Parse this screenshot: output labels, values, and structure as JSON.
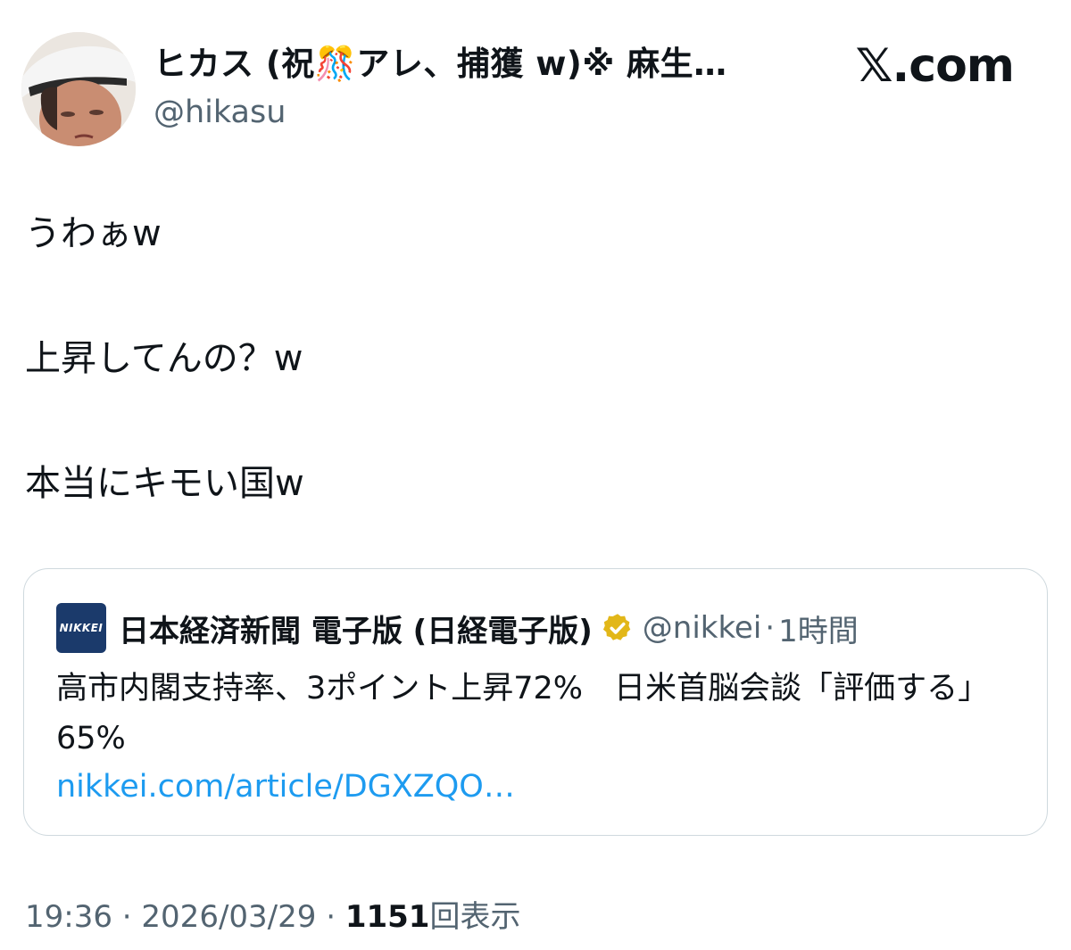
{
  "header": {
    "display_name": "ヒカス (祝🎊アレ、捕獲 w)※ 麻生…",
    "handle": "@hikasu",
    "brand": "𝕏.com"
  },
  "tweet": {
    "lines": [
      "うわぁw",
      "上昇してんの？w",
      "本当にキモい国w"
    ]
  },
  "quote": {
    "logo_text": "NIKKEI",
    "name": "日本経済新聞 電子版 (日経電子版)",
    "handle": "@nikkei",
    "separator": "·",
    "time": "1時間",
    "text": "高市内閣支持率、3ポイント上昇72%　日米首脳会談「評価する」65%",
    "link": "nikkei.com/article/DGXZQO…"
  },
  "meta": {
    "time": "19:36",
    "sep1": "·",
    "date": "2026/03/29",
    "sep2": "·",
    "views_count": "1151",
    "views_label": "回表示"
  },
  "colors": {
    "text": "#0f1419",
    "secondary": "#536471",
    "link": "#1d9bf0",
    "border": "#cfd9de",
    "verified_gold": "#e2b719",
    "nikkei_blue": "#1b3a6b"
  },
  "icons": {
    "verified": "verified-badge-icon",
    "avatar": "profile-avatar"
  }
}
